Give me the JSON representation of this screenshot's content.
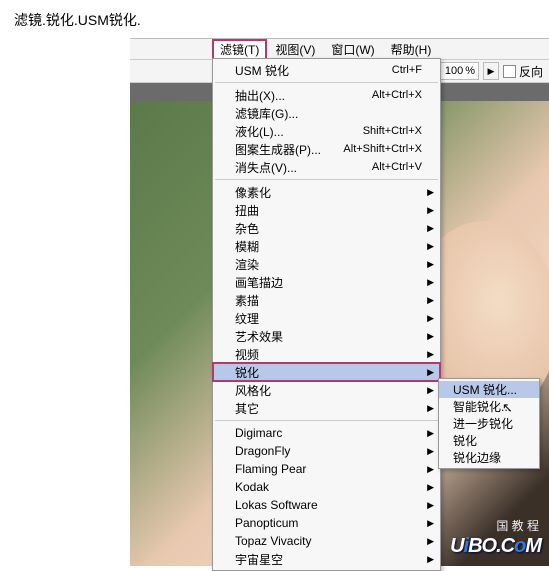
{
  "caption": "滤镜.锐化.USM锐化.",
  "menubar": {
    "items": [
      {
        "label": "滤镜(T)",
        "active": true
      },
      {
        "label": "视图(V)"
      },
      {
        "label": "窗口(W)"
      },
      {
        "label": "帮助(H)"
      }
    ]
  },
  "toolbar": {
    "zoom_value": "100",
    "zoom_pct": "%",
    "step_glyph": "▶",
    "reverse_label": "反向"
  },
  "menu": {
    "groups": [
      [
        {
          "label": "USM 锐化",
          "shortcut": "Ctrl+F"
        }
      ],
      [
        {
          "label": "抽出(X)...",
          "shortcut": "Alt+Ctrl+X"
        },
        {
          "label": "滤镜库(G)...",
          "shortcut": ""
        },
        {
          "label": "液化(L)...",
          "shortcut": "Shift+Ctrl+X"
        },
        {
          "label": "图案生成器(P)...",
          "shortcut": "Alt+Shift+Ctrl+X"
        },
        {
          "label": "消失点(V)...",
          "shortcut": "Alt+Ctrl+V"
        }
      ],
      [
        {
          "label": "像素化",
          "submenu": true
        },
        {
          "label": "扭曲",
          "submenu": true
        },
        {
          "label": "杂色",
          "submenu": true
        },
        {
          "label": "模糊",
          "submenu": true
        },
        {
          "label": "渲染",
          "submenu": true
        },
        {
          "label": "画笔描边",
          "submenu": true
        },
        {
          "label": "素描",
          "submenu": true
        },
        {
          "label": "纹理",
          "submenu": true
        },
        {
          "label": "艺术效果",
          "submenu": true
        },
        {
          "label": "视频",
          "submenu": true
        },
        {
          "label": "锐化",
          "submenu": true,
          "highlighted": true,
          "boxed": true
        },
        {
          "label": "风格化",
          "submenu": true
        },
        {
          "label": "其它",
          "submenu": true
        }
      ],
      [
        {
          "label": "Digimarc",
          "submenu": true
        },
        {
          "label": "DragonFly",
          "submenu": true
        },
        {
          "label": "Flaming Pear",
          "submenu": true
        },
        {
          "label": "Kodak",
          "submenu": true
        },
        {
          "label": "Lokas Software",
          "submenu": true
        },
        {
          "label": "Panopticum",
          "submenu": true
        },
        {
          "label": "Topaz Vivacity",
          "submenu": true
        },
        {
          "label": "宇宙星空",
          "submenu": true
        }
      ]
    ]
  },
  "submenu": {
    "items": [
      {
        "label": "USM 锐化...",
        "highlighted": true
      },
      {
        "label": "智能锐化..."
      },
      {
        "label": "进一步锐化"
      },
      {
        "label": "锐化"
      },
      {
        "label": "锐化边缘"
      }
    ]
  },
  "watermark": {
    "sub": "国 教 程",
    "text_u": "U",
    "text_i": "i",
    "text_bo": "BO.",
    "text_c": "C",
    "text_o": "o",
    "text_m": "M"
  },
  "arrow_glyph": "▶"
}
